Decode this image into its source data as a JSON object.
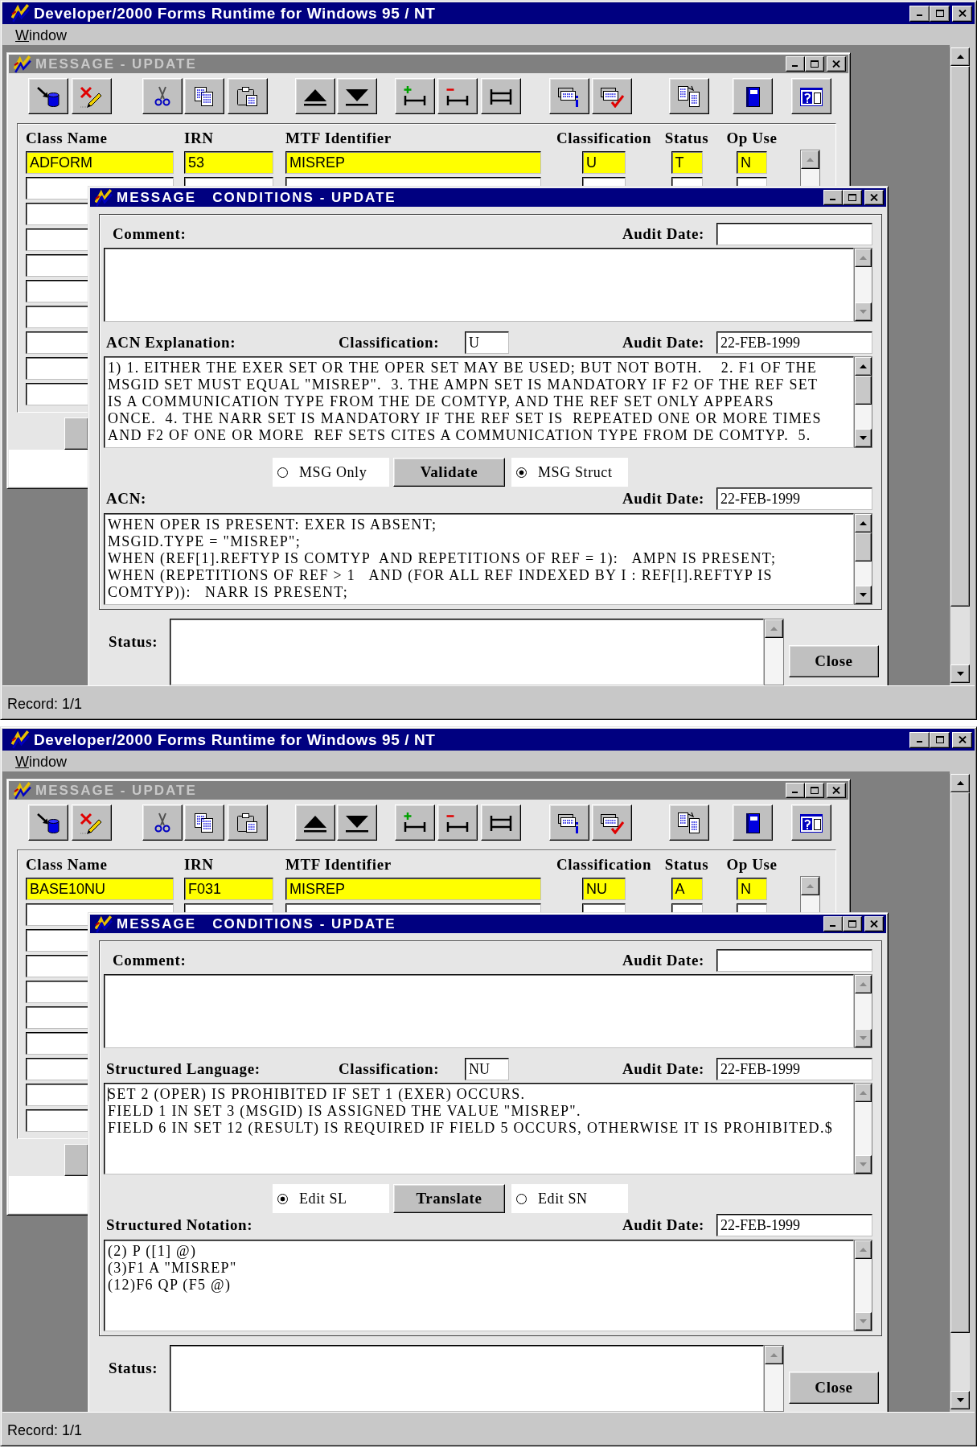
{
  "screens": [
    {
      "window": {
        "title": "Developer/2000 Forms Runtime for Windows 95 / NT",
        "active": true
      },
      "menu": [
        {
          "label": "Window"
        }
      ],
      "form_window": {
        "title": "MESSAGE - UPDATE",
        "active": false,
        "columns": [
          "Class Name",
          "IRN",
          "MTF Identifier",
          "Classification",
          "Status",
          "Op Use"
        ],
        "current_record": [
          "ADFORM",
          "53",
          "MISREP",
          "U",
          "T",
          "N"
        ]
      },
      "dialog": {
        "title": "MESSAGE   CONDITIONS - UPDATE",
        "active": true,
        "comment": {
          "label": "Comment:",
          "audit_label": "Audit Date:"
        },
        "upper": {
          "label": "ACN Explanation:",
          "classification_label": "Classification:",
          "classification": "U",
          "audit_label": "Audit Date:",
          "audit_date": "22-FEB-1999",
          "lines": [
            "1) 1. EITHER THE EXER SET OR THE OPER SET MAY BE USED; BUT NOT BOTH.    2. F1 OF THE",
            "MSGID SET MUST EQUAL \"MISREP\".  3. THE AMPN SET IS MANDATORY IF F2 OF THE REF SET",
            "IS A COMMUNICATION TYPE FROM THE DE COMTYP, AND THE REF SET ONLY APPEARS",
            "ONCE.  4. THE NARR SET IS MANDATORY IF THE REF SET IS  REPEATED ONE OR MORE TIMES",
            "AND F2 OF ONE OR MORE  REF SETS CITES A COMMUNICATION TYPE FROM DE COMTYP.  5."
          ]
        },
        "modes": [
          {
            "label": "MSG Only",
            "selected": false
          },
          {
            "label": "MSG Struct",
            "selected": true
          }
        ],
        "action_button": "Validate",
        "lower": {
          "label": "ACN:",
          "audit_label": "Audit Date:",
          "audit_date": "22-FEB-1999",
          "lines": [
            "WHEN OPER IS PRESENT: EXER IS ABSENT;",
            "MSGID.TYPE = \"MISREP\";",
            "WHEN (REF[1].REFTYP IS COMTYP  AND REPETITIONS OF REF = 1):   AMPN IS PRESENT;",
            "WHEN (REPETITIONS OF REF > 1   AND (FOR ALL REF INDEXED BY I : REF[I].REFTYP IS",
            "COMTYP)):   NARR IS PRESENT;"
          ]
        },
        "status_label": "Status:",
        "close_button": "Close"
      },
      "status_bar": "Record: 1/1"
    },
    {
      "window": {
        "title": "Developer/2000 Forms Runtime for Windows 95 / NT",
        "active": true
      },
      "menu": [
        {
          "label": "Window"
        }
      ],
      "form_window": {
        "title": "MESSAGE - UPDATE",
        "active": false,
        "columns": [
          "Class Name",
          "IRN",
          "MTF Identifier",
          "Classification",
          "Status",
          "Op Use"
        ],
        "current_record": [
          "BASE10NU",
          "F031",
          "MISREP",
          "NU",
          "A",
          "N"
        ]
      },
      "dialog": {
        "title": "MESSAGE   CONDITIONS - UPDATE",
        "active": true,
        "comment": {
          "label": "Comment:",
          "audit_label": "Audit Date:"
        },
        "upper": {
          "label": "Structured Language:",
          "classification_label": "Classification:",
          "classification": "NU",
          "audit_label": "Audit Date:",
          "audit_date": "22-FEB-1999",
          "caret": true,
          "lines": [
            "SET 2 (OPER) IS PROHIBITED IF SET 1 (EXER) OCCURS.",
            "FIELD 1 IN SET 3 (MSGID) IS ASSIGNED THE VALUE \"MISREP\".",
            "FIELD 6 IN SET 12 (RESULT) IS REQUIRED IF FIELD 5 OCCURS, OTHERWISE IT IS PROHIBITED.$"
          ]
        },
        "modes": [
          {
            "label": "Edit SL",
            "selected": true
          },
          {
            "label": "Edit SN",
            "selected": false
          }
        ],
        "action_button": "Translate",
        "lower": {
          "label": "Structured Notation:",
          "audit_label": "Audit Date:",
          "audit_date": "22-FEB-1999",
          "lines": [
            "(2) P ([1] @)",
            "(3)F1 A \"MISREP\"",
            "(12)F6 QP (F5 @)"
          ]
        },
        "status_label": "Status:",
        "close_button": "Close"
      },
      "status_bar": "Record: 1/1"
    }
  ]
}
